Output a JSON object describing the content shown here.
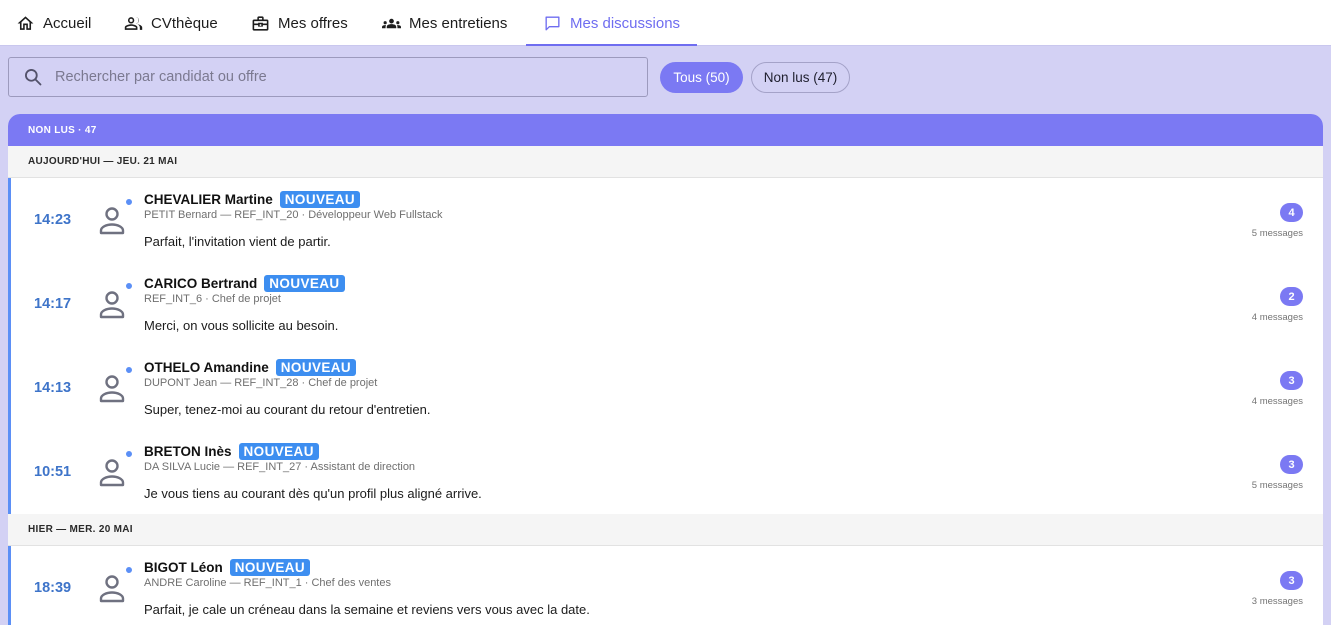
{
  "nav": {
    "items": [
      {
        "label": "Accueil",
        "icon": "home-icon"
      },
      {
        "label": "CVthèque",
        "icon": "users-icon"
      },
      {
        "label": "Mes offres",
        "icon": "briefcase-icon"
      },
      {
        "label": "Mes entretiens",
        "icon": "group-icon"
      },
      {
        "label": "Mes discussions",
        "icon": "chat-icon"
      }
    ],
    "active": "Mes discussions",
    "accent_color": "#6f6df0"
  },
  "search": {
    "placeholder": "Rechercher par candidat ou offre",
    "value": ""
  },
  "filters": {
    "all_label": "Tous (50)",
    "unread_label": "Non lus (47)",
    "selected": "Tous (50)"
  },
  "list": {
    "header": "NON LUS · 47",
    "groups": [
      {
        "label": "AUJOURD'HUI — JEU. 21 MAI",
        "conversations": [
          {
            "time": "14:23",
            "name": "CHEVALIER Martine",
            "badge": "NOUVEAU",
            "sub": "PETIT Bernard — REF_INT_20 · Développeur Web Fullstack",
            "message": "Parfait, l'invitation vient de partir.",
            "unread": "4",
            "messages": "5 messages"
          },
          {
            "time": "14:17",
            "name": "CARICO Bertrand",
            "badge": "NOUVEAU",
            "sub": "REF_INT_6 · Chef de projet",
            "message": "Merci, on vous sollicite au besoin.",
            "unread": "2",
            "messages": "4 messages"
          },
          {
            "time": "14:13",
            "name": "OTHELO Amandine",
            "badge": "NOUVEAU",
            "sub": "DUPONT Jean — REF_INT_28 · Chef de projet",
            "message": "Super, tenez-moi au courant du retour d'entretien.",
            "unread": "3",
            "messages": "4 messages"
          },
          {
            "time": "10:51",
            "name": "BRETON Inès",
            "badge": "NOUVEAU",
            "sub": "DA SILVA Lucie — REF_INT_27 · Assistant de direction",
            "message": "Je vous tiens au courant dès qu'un profil plus aligné arrive.",
            "unread": "3",
            "messages": "5 messages"
          }
        ]
      },
      {
        "label": "HIER — MER. 20 MAI",
        "conversations": [
          {
            "time": "18:39",
            "name": "BIGOT Léon",
            "badge": "NOUVEAU",
            "sub": "ANDRE Caroline — REF_INT_1 · Chef des ventes",
            "message": "Parfait, je cale un créneau dans la semaine et reviens vers vous avec la date.",
            "unread": "3",
            "messages": "3 messages"
          }
        ]
      }
    ]
  },
  "colors": {
    "accent": "#7b79f3",
    "page_bg": "#d3d1f4",
    "unread_bar": "#5b8ff6",
    "badge": "#3d8ef0",
    "time": "#3e74c9"
  }
}
